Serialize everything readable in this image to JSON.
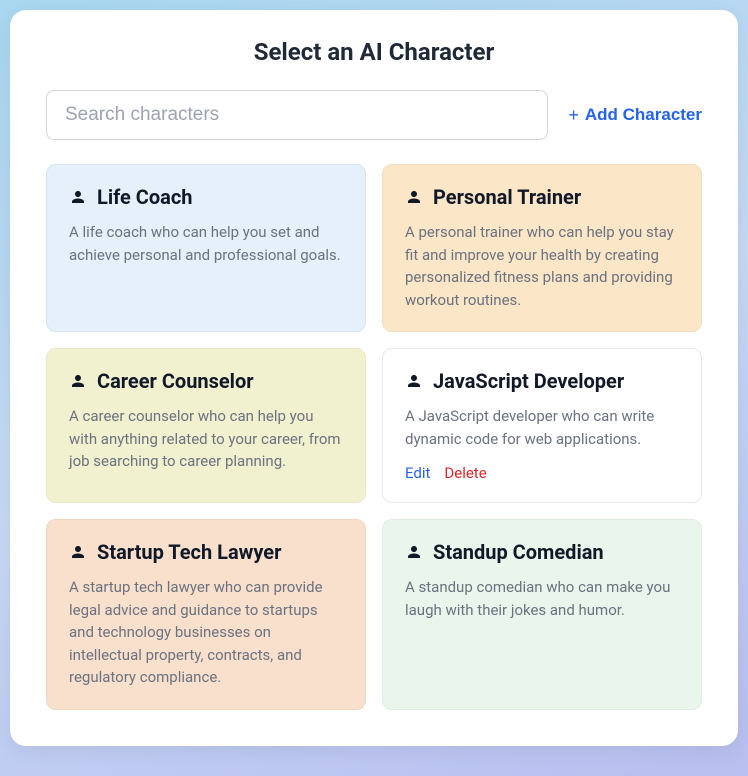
{
  "header": {
    "title": "Select an AI Character"
  },
  "search": {
    "placeholder": "Search characters"
  },
  "add_button": {
    "label": "Add Character"
  },
  "actions": {
    "edit": "Edit",
    "delete": "Delete"
  },
  "cards": [
    {
      "title": "Life Coach",
      "desc": "A life coach who can help you set and achieve personal and professional goals.",
      "color": "blue",
      "has_actions": false
    },
    {
      "title": "Personal Trainer",
      "desc": "A personal trainer who can help you stay fit and improve your health by creating personalized fitness plans and providing workout routines.",
      "color": "orange",
      "has_actions": false
    },
    {
      "title": "Career Counselor",
      "desc": "A career counselor who can help you with anything related to your career, from job searching to career planning.",
      "color": "yellow",
      "has_actions": false
    },
    {
      "title": "JavaScript Developer",
      "desc": "A JavaScript developer who can write dynamic code for web applications.",
      "color": "white",
      "has_actions": true
    },
    {
      "title": "Startup Tech Lawyer",
      "desc": "A startup tech lawyer who can provide legal advice and guidance to startups and technology businesses on intellectual property, contracts, and regulatory compliance.",
      "color": "peach",
      "has_actions": false
    },
    {
      "title": "Standup Comedian",
      "desc": "A standup comedian who can make you laugh with their jokes and humor.",
      "color": "green",
      "has_actions": false
    }
  ]
}
